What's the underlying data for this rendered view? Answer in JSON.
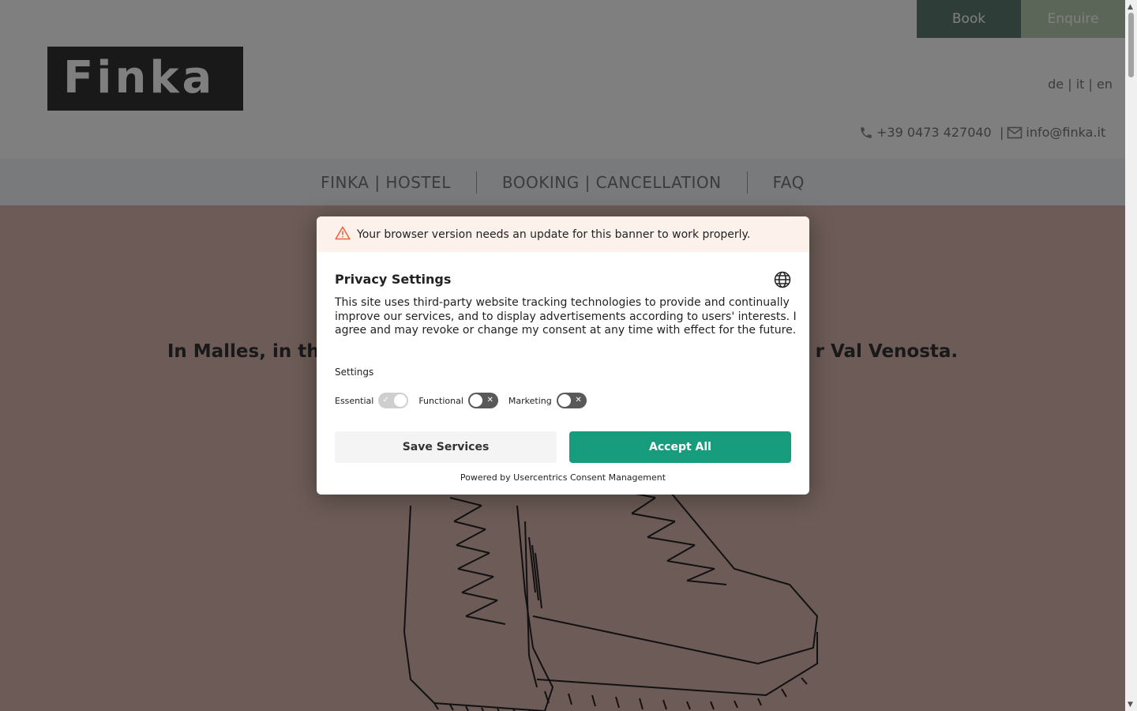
{
  "header": {
    "logo_text": "Finka",
    "book_label": "Book",
    "enquire_label": "Enquire",
    "languages": [
      "de",
      "it",
      "en"
    ],
    "phone": "+39 0473 427040",
    "email": "info@finka.it",
    "separator": "|"
  },
  "nav": {
    "items": [
      {
        "label": "FINKA | HOSTEL"
      },
      {
        "label": "BOOKING | CANCELLATION"
      },
      {
        "label": "FAQ"
      }
    ]
  },
  "hero": {
    "text_left": "In Malles, in th",
    "text_right": "r Val Venosta."
  },
  "consent": {
    "warning": "Your browser version needs an update for this banner to work properly.",
    "title": "Privacy Settings",
    "description": "This site uses third-party website tracking technologies to provide and continually improve our services, and to display advertisements according to users' interests. I agree and may revoke or change my consent at any time with effect for the future.",
    "settings_label": "Settings",
    "toggles": [
      {
        "label": "Essential",
        "state": "on"
      },
      {
        "label": "Functional",
        "state": "off"
      },
      {
        "label": "Marketing",
        "state": "off"
      }
    ],
    "save_label": "Save Services",
    "accept_label": "Accept All",
    "powered_by": "Powered by Usercentrics Consent Management"
  },
  "colors": {
    "accept": "#179c7d",
    "book": "#5e7a73",
    "enquire": "#b8cdb0",
    "hero_bg": "#d9b7ac"
  },
  "icons": [
    "phone-icon",
    "mail-icon",
    "warning-icon",
    "globe-icon",
    "check-icon",
    "close-icon"
  ]
}
